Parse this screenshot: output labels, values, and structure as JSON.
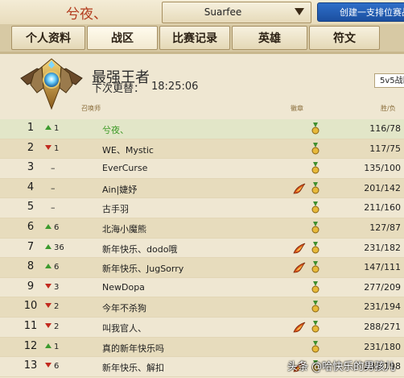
{
  "topbar": {
    "player_name": "兮夜、",
    "server": "Suarfee",
    "create_button": "创建一支排位赛战队"
  },
  "tabs": [
    {
      "label": "个人资料"
    },
    {
      "label": "战区",
      "active": true
    },
    {
      "label": "比赛记录"
    },
    {
      "label": "英雄"
    },
    {
      "label": "符文"
    }
  ],
  "header": {
    "tier": "最强王者",
    "update_label": "下次更替：",
    "update_time": "18:25:06",
    "mode_select": "5v5战队"
  },
  "table": {
    "col_name": "召唤师",
    "col_badge": "徽章",
    "col_record": "胜/负",
    "rows": [
      {
        "rank": "1",
        "dir": "up",
        "change": "1",
        "name": "兮夜、",
        "badges": [
          "medal"
        ],
        "record": "116/78"
      },
      {
        "rank": "2",
        "dir": "down",
        "change": "1",
        "name": "WE、Mystic",
        "badges": [
          "medal"
        ],
        "record": "117/75"
      },
      {
        "rank": "3",
        "dir": "none",
        "change": "–",
        "name": "EverCurse",
        "badges": [
          "medal"
        ],
        "record": "135/100"
      },
      {
        "rank": "4",
        "dir": "none",
        "change": "–",
        "name": "Ain|婕妤",
        "badges": [
          "flame",
          "medal"
        ],
        "record": "201/142"
      },
      {
        "rank": "5",
        "dir": "none",
        "change": "–",
        "name": "古手羽",
        "badges": [
          "medal"
        ],
        "record": "211/160"
      },
      {
        "rank": "6",
        "dir": "up",
        "change": "6",
        "name": "北海小魔熊",
        "badges": [
          "medal"
        ],
        "record": "127/87"
      },
      {
        "rank": "7",
        "dir": "up",
        "change": "36",
        "name": "新年快乐、dodo哦",
        "badges": [
          "flame",
          "medal"
        ],
        "record": "231/182"
      },
      {
        "rank": "8",
        "dir": "up",
        "change": "6",
        "name": "新年快乐、JugSorry",
        "badges": [
          "flame",
          "medal"
        ],
        "record": "147/111"
      },
      {
        "rank": "9",
        "dir": "down",
        "change": "3",
        "name": "NewDopa",
        "badges": [
          "medal"
        ],
        "record": "277/209"
      },
      {
        "rank": "10",
        "dir": "down",
        "change": "2",
        "name": "今年不杀狗",
        "badges": [
          "medal"
        ],
        "record": "231/194"
      },
      {
        "rank": "11",
        "dir": "down",
        "change": "2",
        "name": "叫我官人、",
        "badges": [
          "flame",
          "medal"
        ],
        "record": "288/271"
      },
      {
        "rank": "12",
        "dir": "up",
        "change": "1",
        "name": "真的新年快乐吗",
        "badges": [
          "medal"
        ],
        "record": "231/180"
      },
      {
        "rank": "13",
        "dir": "down",
        "change": "6",
        "name": "新年快乐、解扣",
        "badges": [
          "flame",
          "medal"
        ],
        "record": "239/198"
      }
    ]
  },
  "watermark": "头条 @哈快乐的男孩儿"
}
